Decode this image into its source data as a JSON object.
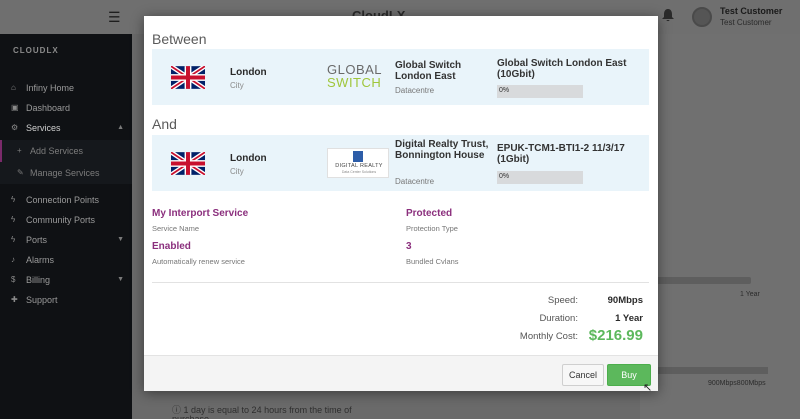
{
  "topbar": {
    "brand": "CloudLX",
    "user_name": "Test Customer",
    "user_sub": "Test Customer",
    "hamburger_icon": "menu-icon",
    "bell_icon": "bell-icon"
  },
  "sidebar": {
    "logo": "CLOUDLX",
    "items": [
      {
        "label": "Infiny Home",
        "icon": "home-icon"
      },
      {
        "label": "Dashboard",
        "icon": "dashboard-icon"
      },
      {
        "label": "Services",
        "icon": "services-icon",
        "caret": "▲"
      },
      {
        "label": "Add Services",
        "icon": "plus-icon"
      },
      {
        "label": "Manage Services",
        "icon": "wrench-icon"
      },
      {
        "label": "Connection Points",
        "icon": "plug-icon"
      },
      {
        "label": "Community Ports",
        "icon": "plug-icon"
      },
      {
        "label": "Ports",
        "icon": "plug-icon",
        "caret": "▼"
      },
      {
        "label": "Alarms",
        "icon": "alarm-icon"
      },
      {
        "label": "Billing",
        "icon": "dollar-icon",
        "caret": "▼"
      },
      {
        "label": "Support",
        "icon": "support-icon"
      }
    ]
  },
  "background": {
    "year_label": "1 Year",
    "mbps_label": "900Mbps800Mbps",
    "info_line1": "1 day is equal to 24 hours from the time of",
    "info_line2": "purchase"
  },
  "modal": {
    "between_title": "Between",
    "and_title": "And",
    "a_end": {
      "city": "London",
      "city_sub": "City",
      "datacentre": "Global Switch London East",
      "datacentre_sub": "Datacentre",
      "logo_text_top": "GLOBAL",
      "logo_text_bottom": "SWITCH",
      "service": "Global Switch London East (10Gbit)",
      "usage": "0%",
      "usage_fraction": 0
    },
    "b_end": {
      "city": "London",
      "city_sub": "City",
      "datacentre": "Digital Realty Trust, Bonnington House",
      "datacentre_sub": "Datacentre",
      "logo_text_top": "DIGITAL REALTY",
      "logo_text_bottom": "Data Center Solutions",
      "service": "EPUK-TCM1-BTI1-2 11/3/17 (1Gbit)",
      "usage": "0%",
      "usage_fraction": 0
    },
    "details": {
      "service_name": "My Interport Service",
      "service_name_sub": "Service Name",
      "protection": "Protected",
      "protection_sub": "Protection Type",
      "renew": "Enabled",
      "renew_sub": "Automatically renew service",
      "cvlans": "3",
      "cvlans_sub": "Bundled Cvlans"
    },
    "summary": {
      "speed_label": "Speed:",
      "speed_value": "90Mbps",
      "duration_label": "Duration:",
      "duration_value": "1 Year",
      "cost_label": "Monthly Cost:",
      "cost_value": "$216.99"
    },
    "buttons": {
      "cancel": "Cancel",
      "buy": "Buy"
    }
  },
  "colors": {
    "accent_purple": "#8b2f7d",
    "success_green": "#5cb85c",
    "card_blue": "#e9f4fa"
  }
}
